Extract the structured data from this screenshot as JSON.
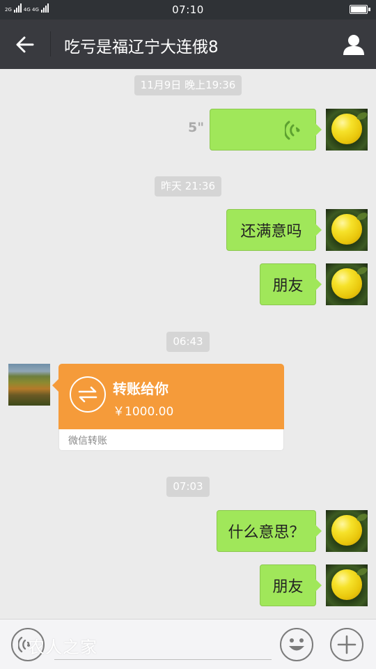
{
  "status_bar": {
    "net_left": "2G",
    "net_right": "4G 4G",
    "time": "07:10",
    "battery_level": 0.9
  },
  "header": {
    "title": "吃亏是福辽宁大连俄8",
    "back_icon": "back-arrow-icon",
    "profile_icon": "user-profile-icon",
    "bar_color": "#393a3f"
  },
  "messages": {
    "timestamps": [
      "11月9日 晚上19:36",
      "昨天 21:36",
      "06:43",
      "07:03"
    ],
    "voice_duration": "5\"",
    "text": [
      "还满意吗",
      "朋友",
      "什么意思？",
      "朋友"
    ],
    "bubble_color": "#a0e75a"
  },
  "transfer": {
    "title": "转账给你",
    "amount": "￥1000.00",
    "label": "微信转账",
    "color": "#f59b3a",
    "icon": "transfer-arrows-icon"
  },
  "input_bar": {
    "watermark": "农人之家",
    "voice_icon": "voice-input-icon",
    "emoji_icon": "emoji-icon",
    "plus_icon": "plus-icon"
  }
}
